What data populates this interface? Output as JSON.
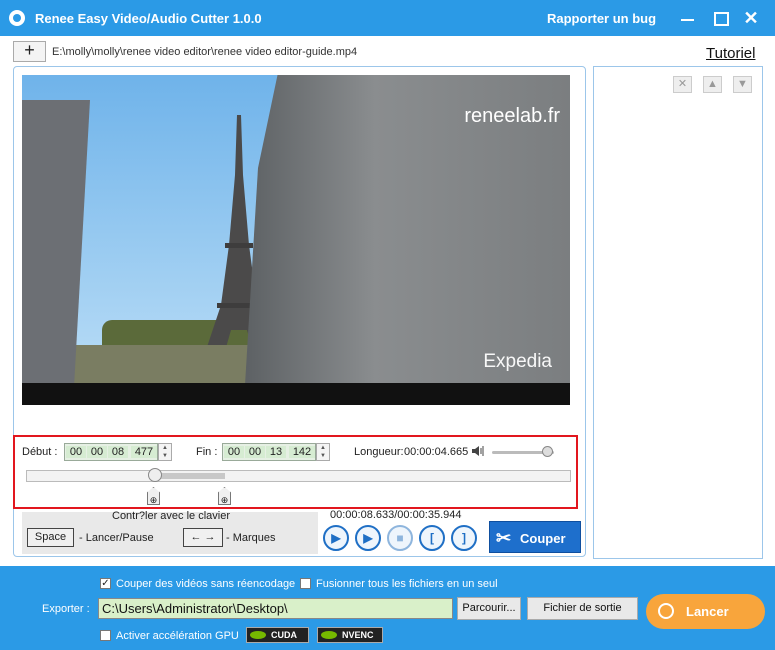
{
  "window": {
    "title": "Renee Easy Video/Audio Cutter 1.0.0",
    "bug_link": "Rapporter un bug",
    "close_glyph": "✕"
  },
  "toolbar": {
    "add_glyph": "+",
    "file_path": "E:\\molly\\molly\\renee video editor\\renee video editor-guide.mp4",
    "tutorial_link": "Tutoriel"
  },
  "rightpanel": {
    "remove_glyph": "✕",
    "up_glyph": "▲",
    "down_glyph": "▼"
  },
  "video": {
    "watermark": "reneelab.fr",
    "brand": "Expedia"
  },
  "trim": {
    "start_label": "Début :",
    "start": [
      "00",
      "00",
      "08",
      "477"
    ],
    "end_label": "Fin :",
    "end": [
      "00",
      "00",
      "13",
      "142"
    ],
    "length_label": "Longueur:",
    "length_value": "00:00:04.665",
    "spin_up": "▲",
    "spin_down": "▼",
    "marker_glyph": "⊕",
    "volume_level": 0.9
  },
  "keyboard": {
    "hint": "Contr?ler avec le clavier",
    "space_key": "Space",
    "space_label": "- Lancer/Pause",
    "arrows_key": "← →",
    "arrows_label": "- Marques"
  },
  "player": {
    "time_info": "00:00:08.633/00:00:35.944",
    "play_glyph": "▶",
    "play_sel_glyph": "▶",
    "stop_glyph": "■",
    "mark_in_glyph": "[",
    "mark_out_glyph": "]"
  },
  "cut_button": {
    "label": "Couper",
    "icon": "✂"
  },
  "export": {
    "opt_no_reencode": "Couper des vidéos sans réencodage",
    "opt_no_reencode_checked": true,
    "opt_merge": "Fusionner tous les fichiers en un seul",
    "opt_merge_checked": false,
    "export_label": "Exporter :",
    "output_path": "C:\\Users\\Administrator\\Desktop\\",
    "browse_button": "Parcourir...",
    "output_file_button": "Fichier de sortie",
    "gpu_label": "Activer accélération GPU",
    "gpu_checked": false,
    "cuda": "CUDA",
    "nvenc": "NVENC",
    "launch_button": "Lancer",
    "check_glyph": "✓"
  }
}
